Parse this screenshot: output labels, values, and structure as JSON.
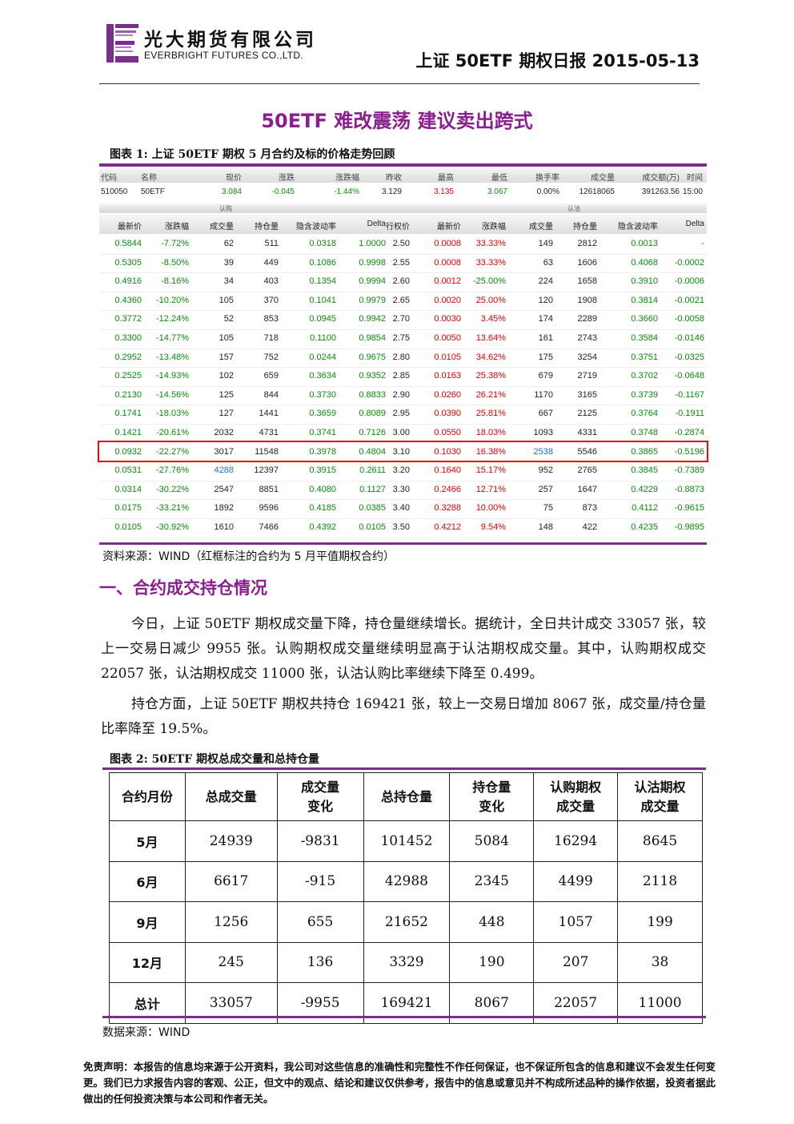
{
  "header": {
    "company_cn": "光大期货有限公司",
    "company_en": "EVERBRIGHT FUTURES CO.,LTD.",
    "report_title": "上证 50ETF 期权日报 2015-05-13"
  },
  "main_title": "50ETF 难改震荡  建议卖出跨式",
  "fig1": {
    "caption": "图表 1: 上证 50ETF 期权 5 月合约及标的价格走势回顾",
    "quote_headers": [
      "代码",
      "名称",
      "现价",
      "涨跌",
      "涨跌幅",
      "昨收",
      "最高",
      "最低",
      "换手率",
      "成交量",
      "成交额(万)",
      "时间"
    ],
    "quote_values": [
      "510050",
      "50ETF",
      "3.084",
      "-0.045",
      "-1.44%",
      "3.129",
      "3.135",
      "3.067",
      "0.00%",
      "12618065",
      "391263.56",
      "15:00"
    ],
    "group_call": "认购",
    "group_put": "认沽",
    "col_headers": [
      "最新价",
      "涨跌幅",
      "成交量",
      "持仓量",
      "隐含波动率",
      "Delta",
      "行权价",
      "最新价",
      "涨跌幅",
      "成交量",
      "持仓量",
      "隐含波动率",
      "Delta"
    ],
    "rows": [
      [
        "0.5844",
        "-7.72%",
        "62",
        "511",
        "0.0318",
        "1.0000",
        "2.50",
        "0.0008",
        "33.33%",
        "149",
        "2812",
        "0.0013",
        "-"
      ],
      [
        "0.5305",
        "-8.50%",
        "39",
        "449",
        "0.1086",
        "0.9998",
        "2.55",
        "0.0008",
        "33.33%",
        "63",
        "1606",
        "0.4068",
        "-0.0002"
      ],
      [
        "0.4916",
        "-8.16%",
        "34",
        "403",
        "0.1354",
        "0.9994",
        "2.60",
        "0.0012",
        "-25.00%",
        "224",
        "1658",
        "0.3910",
        "-0.0006"
      ],
      [
        "0.4360",
        "-10.20%",
        "105",
        "370",
        "0.1041",
        "0.9979",
        "2.65",
        "0.0020",
        "25.00%",
        "120",
        "1908",
        "0.3814",
        "-0.0021"
      ],
      [
        "0.3772",
        "-12.24%",
        "52",
        "853",
        "0.0945",
        "0.9942",
        "2.70",
        "0.0030",
        "3.45%",
        "174",
        "2289",
        "0.3660",
        "-0.0058"
      ],
      [
        "0.3300",
        "-14.77%",
        "105",
        "718",
        "0.1100",
        "0.9854",
        "2.75",
        "0.0050",
        "13.64%",
        "161",
        "2743",
        "0.3584",
        "-0.0146"
      ],
      [
        "0.2952",
        "-13.48%",
        "157",
        "752",
        "0.0244",
        "0.9675",
        "2.80",
        "0.0105",
        "34.62%",
        "175",
        "3254",
        "0.3751",
        "-0.0325"
      ],
      [
        "0.2525",
        "-14.93%",
        "102",
        "659",
        "0.3634",
        "0.9352",
        "2.85",
        "0.0163",
        "25.38%",
        "679",
        "2719",
        "0.3702",
        "-0.0648"
      ],
      [
        "0.2130",
        "-14.56%",
        "125",
        "844",
        "0.3730",
        "0.8833",
        "2.90",
        "0.0260",
        "26.21%",
        "1170",
        "3165",
        "0.3739",
        "-0.1167"
      ],
      [
        "0.1741",
        "-18.03%",
        "127",
        "1441",
        "0.3659",
        "0.8089",
        "2.95",
        "0.0390",
        "25.81%",
        "667",
        "2125",
        "0.3764",
        "-0.1911"
      ],
      [
        "0.1421",
        "-20.61%",
        "2032",
        "4731",
        "0.3741",
        "0.7126",
        "3.00",
        "0.0550",
        "18.03%",
        "1093",
        "4331",
        "0.3748",
        "-0.2874"
      ],
      [
        "0.0932",
        "-22.27%",
        "3017",
        "11548",
        "0.3978",
        "0.4804",
        "3.10",
        "0.1030",
        "16.38%",
        "2538",
        "5546",
        "0.3865",
        "-0.5196"
      ],
      [
        "0.0531",
        "-27.76%",
        "4288",
        "12397",
        "0.3915",
        "0.2611",
        "3.20",
        "0.1640",
        "15.17%",
        "952",
        "2765",
        "0.3845",
        "-0.7389"
      ],
      [
        "0.0314",
        "-30.22%",
        "2547",
        "8851",
        "0.4080",
        "0.1127",
        "3.30",
        "0.2466",
        "12.71%",
        "257",
        "1647",
        "0.4229",
        "-0.8873"
      ],
      [
        "0.0175",
        "-33.21%",
        "1892",
        "9596",
        "0.4185",
        "0.0385",
        "3.40",
        "0.3288",
        "10.00%",
        "75",
        "873",
        "0.4112",
        "-0.9615"
      ],
      [
        "0.0105",
        "-30.92%",
        "1610",
        "7466",
        "0.4392",
        "0.0105",
        "3.50",
        "0.4212",
        "9.54%",
        "148",
        "422",
        "0.4235",
        "-0.9895"
      ]
    ],
    "source": "资料来源：WIND（红框标注的合约为 5 月平值期权合约）",
    "colors": {
      "call_price": "#0b8a0b",
      "put_price": "#d00000",
      "highlight": "#1a6fd8",
      "frame": "#e01010"
    }
  },
  "section1": {
    "heading": "一、合约成交持仓情况",
    "para1": "今日，上证 50ETF 期权成交量下降，持仓量继续增长。据统计，全日共计成交 33057 张，较上一交易日减少 9955 张。认购期权成交量继续明显高于认沽期权成交量。其中，认购期权成交 22057 张，认沽期权成交 11000 张，认沽认购比率继续下降至 0.499。",
    "para2": "持仓方面，上证 50ETF 期权共持仓 169421 张，较上一交易日增加 8067 张，成交量/持仓量比率降至 19.5%。"
  },
  "fig2": {
    "caption": "图表 2: 50ETF 期权总成交量和总持仓量",
    "headers": [
      "合约月份",
      "总成交量",
      "成交量\n变化",
      "总持仓量",
      "持仓量\n变化",
      "认购期权\n成交量",
      "认沽期权\n成交量"
    ],
    "rows": [
      [
        "5月",
        "24939",
        "-9831",
        "101452",
        "5084",
        "16294",
        "8645"
      ],
      [
        "6月",
        "6617",
        "-915",
        "42988",
        "2345",
        "4499",
        "2118"
      ],
      [
        "9月",
        "1256",
        "655",
        "21652",
        "448",
        "1057",
        "199"
      ],
      [
        "12月",
        "245",
        "136",
        "3329",
        "190",
        "207",
        "38"
      ],
      [
        "总计",
        "33057",
        "-9955",
        "169421",
        "8067",
        "22057",
        "11000"
      ]
    ],
    "source": "数据来源：WIND"
  },
  "disclaimer": "免责声明：本报告的信息均来源于公开资料，我公司对这些信息的准确性和完整性不作任何保证，也不保证所包含的信息和建议不会发生任何变更。我们已力求报告内容的客观、公正，但文中的观点、结论和建议仅供参考，报告中的信息或意见并不构成所述品种的操作依据，投资者据此做出的任何投资决策与本公司和作者无关。"
}
